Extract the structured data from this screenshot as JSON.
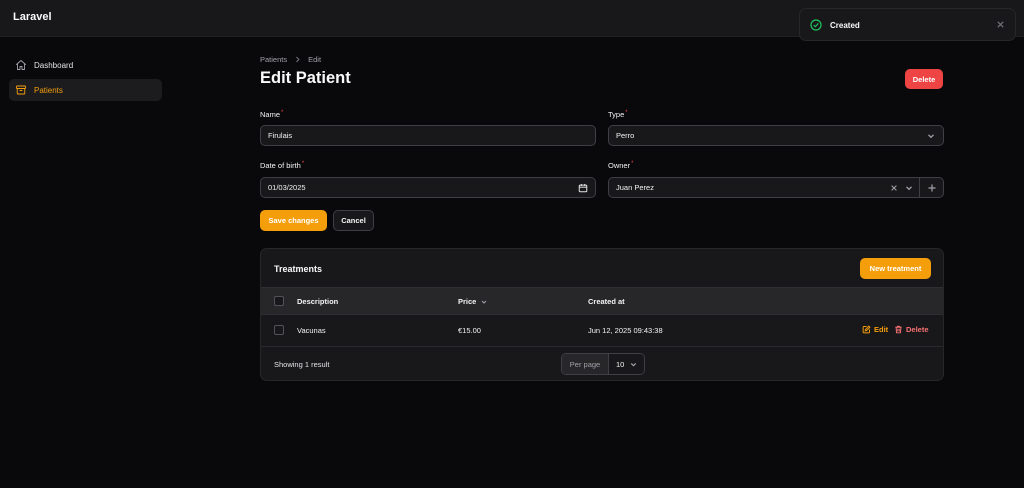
{
  "app": {
    "brand": "Laravel"
  },
  "sidebar": {
    "items": [
      {
        "label": "Dashboard",
        "icon": "home-icon",
        "active": false
      },
      {
        "label": "Patients",
        "icon": "archive-box-icon",
        "active": true
      }
    ]
  },
  "breadcrumb": {
    "items": [
      "Patients",
      "Edit"
    ]
  },
  "page": {
    "title": "Edit Patient",
    "delete_label": "Delete"
  },
  "form": {
    "name": {
      "label": "Name",
      "required_mark": "*",
      "value": "Firulais"
    },
    "type": {
      "label": "Type",
      "required_mark": "*",
      "value": "Perro"
    },
    "date_of_birth": {
      "label": "Date of birth",
      "required_mark": "*",
      "value": "01/03/2025"
    },
    "owner": {
      "label": "Owner",
      "required_mark": "*",
      "value": "Juan Perez"
    },
    "save_label": "Save changes",
    "cancel_label": "Cancel"
  },
  "treatments": {
    "title": "Treatments",
    "new_label": "New treatment",
    "columns": [
      "Description",
      "Price",
      "Created at"
    ],
    "rows": [
      {
        "description": "Vacunas",
        "price": "€15.00",
        "created_at": "Jun 12, 2025 09:43:38",
        "edit_label": "Edit",
        "delete_label": "Delete"
      }
    ],
    "showing": "Showing 1 result",
    "per_page_label": "Per page",
    "per_page_value": "10"
  },
  "toast": {
    "message": "Created",
    "status": "success"
  },
  "colors": {
    "accent": "#f59e0b",
    "danger": "#ef4444",
    "success": "#22c55e",
    "background": "#09090b",
    "surface": "#18181b"
  }
}
